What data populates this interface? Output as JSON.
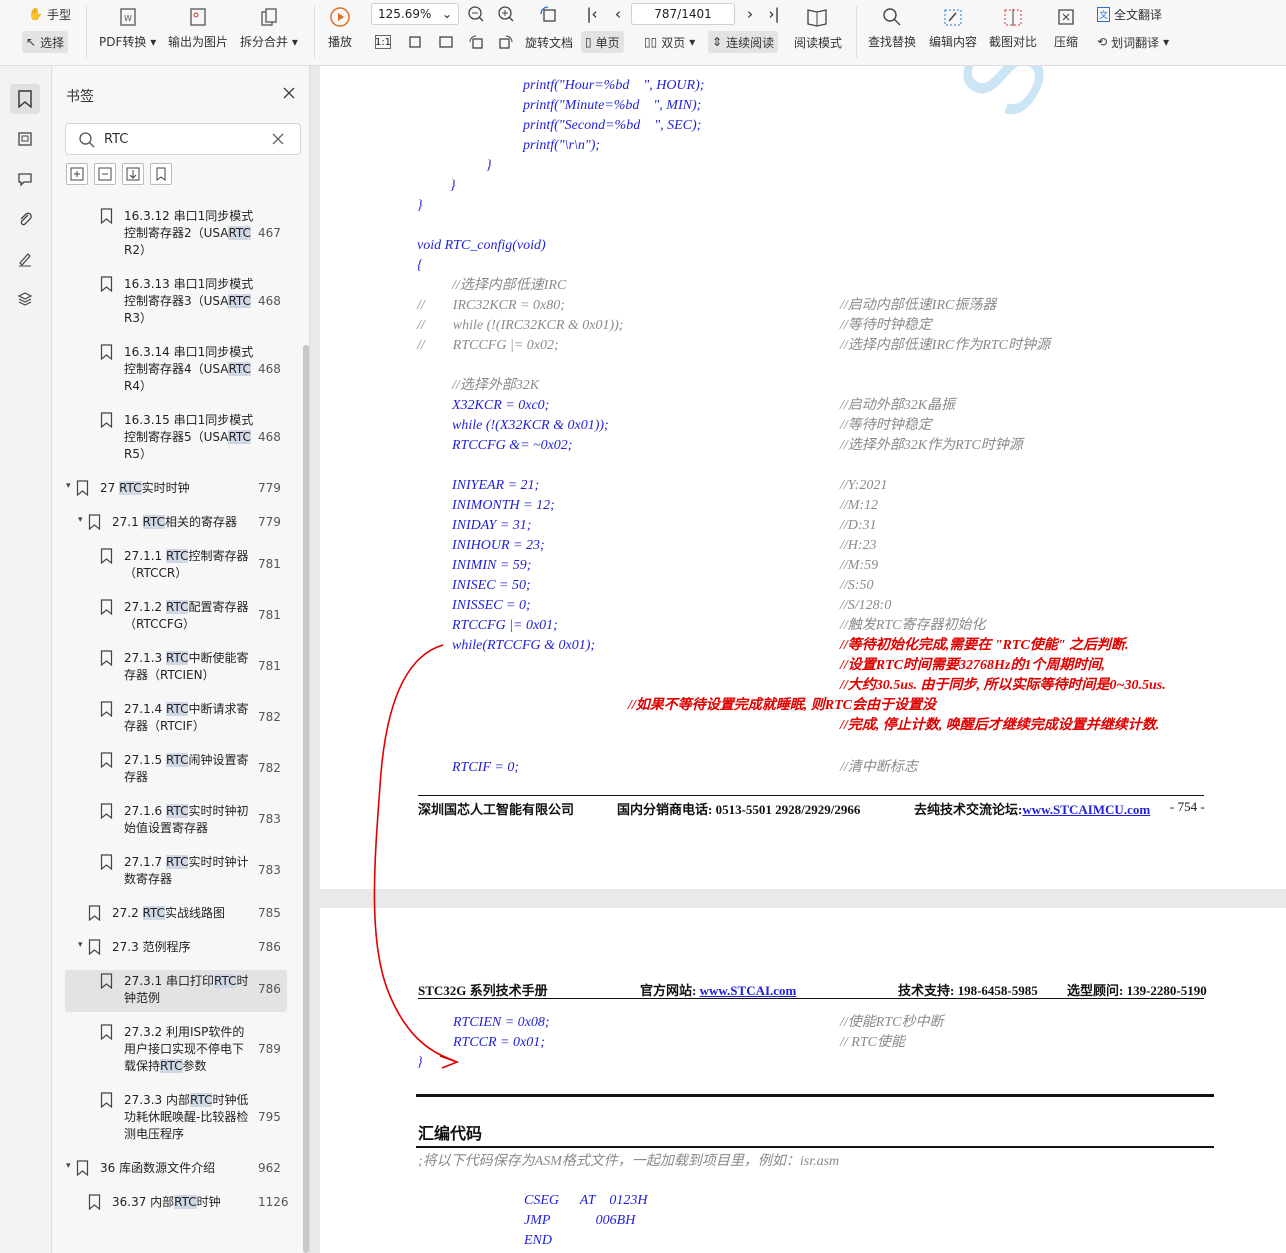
{
  "toolbar": {
    "hand": "手型",
    "select": "选择",
    "pdf_convert": "PDF转换",
    "export_image": "输出为图片",
    "split_merge": "拆分合并",
    "play": "播放",
    "zoom": "125.69%",
    "page": "787/1401",
    "rotate": "旋转文档",
    "single": "单页",
    "double": "双页",
    "continuous": "连续阅读",
    "read_mode": "阅读模式",
    "find_replace": "查找替换",
    "edit_content": "编辑内容",
    "screenshot_compare": "截图对比",
    "compress": "压缩",
    "full_translate": "全文翻译",
    "word_translate": "划词翻译"
  },
  "panel": {
    "title": "书签",
    "search_value": "RTC",
    "items": [
      {
        "text_a": "16.3.12 串口1同步模式\n控制寄存器2（USA",
        "hl": "RTC",
        "text_b": "\nR2）",
        "page": "467"
      },
      {
        "text_a": "16.3.13 串口1同步模式\n控制寄存器3（USA",
        "hl": "RTC",
        "text_b": "\nR3）",
        "page": "468"
      },
      {
        "text_a": "16.3.14 串口1同步模式\n控制寄存器4（USA",
        "hl": "RTC",
        "text_b": "\nR4）",
        "page": "468"
      },
      {
        "text_a": "16.3.15 串口1同步模式\n控制寄存器5（USA",
        "hl": "RTC",
        "text_b": "\nR5）",
        "page": "468"
      },
      {
        "text_a": "27 ",
        "hl": "RTC",
        "text_b": "实时时钟",
        "page": "779"
      },
      {
        "text_a": "27.1 ",
        "hl": "RTC",
        "text_b": "相关的寄存器",
        "page": "779"
      },
      {
        "text_a": "27.1.1 ",
        "hl": "RTC",
        "text_b": "控制寄存器\n（RTCCR）",
        "page": "781"
      },
      {
        "text_a": "27.1.2 ",
        "hl": "RTC",
        "text_b": "配置寄存器\n（RTCCFG）",
        "page": "781"
      },
      {
        "text_a": "27.1.3 ",
        "hl": "RTC",
        "text_b": "中断使能寄\n存器（RTCIEN）",
        "page": "781"
      },
      {
        "text_a": "27.1.4 ",
        "hl": "RTC",
        "text_b": "中断请求寄\n存器（RTCIF）",
        "page": "782"
      },
      {
        "text_a": "27.1.5 ",
        "hl": "RTC",
        "text_b": "闹钟设置寄\n存器",
        "page": "782"
      },
      {
        "text_a": "27.1.6 ",
        "hl": "RTC",
        "text_b": "实时时钟初\n始值设置寄存器",
        "page": "783"
      },
      {
        "text_a": "27.1.7 ",
        "hl": "RTC",
        "text_b": "实时时钟计\n数寄存器",
        "page": "783"
      },
      {
        "text_a": "27.2 ",
        "hl": "RTC",
        "text_b": "实战线路图",
        "page": "785"
      },
      {
        "text_a": "27.3 范例程序",
        "hl": "",
        "text_b": "",
        "page": "786"
      },
      {
        "text_a": "27.3.1 串口打印",
        "hl": "RTC",
        "text_b": "时\n钟范例",
        "page": "786"
      },
      {
        "text_a": "27.3.2 利用ISP软件的\n用户接口实现不停电下\n载保持",
        "hl": "RTC",
        "text_b": "参数",
        "page": "789"
      },
      {
        "text_a": "27.3.3 内部",
        "hl": "RTC",
        "text_b": "时钟低\n功耗休眠唤醒-比较器检\n测电压程序",
        "page": "795"
      },
      {
        "text_a": "36 库函数源文件介绍",
        "hl": "",
        "text_b": "",
        "page": "962"
      },
      {
        "text_a": "36.37 内部",
        "hl": "RTC",
        "text_b": "时钟",
        "page": "1126"
      }
    ]
  },
  "doc": {
    "watermark": "STC MCU",
    "page1": {
      "lines": [
        {
          "text": "printf(\"Hour=%bd    \", HOUR);",
          "cls": "blue"
        },
        {
          "text": "printf(\"Minute=%bd    \", MIN);",
          "cls": "blue"
        },
        {
          "text": "printf(\"Second=%bd    \", SEC);",
          "cls": "blue"
        },
        {
          "text": "printf(\"\\r\\n\");",
          "cls": "blue"
        },
        {
          "text": "}",
          "cls": "blue"
        },
        {
          "text": "}",
          "cls": "blue"
        },
        {
          "text": "}",
          "cls": "blue"
        },
        {
          "text": "void RTC_config(void)",
          "cls": "blue"
        },
        {
          "text": "{",
          "cls": "blue"
        },
        {
          "text": "//选择内部低速IRC",
          "cls": "gray"
        },
        {
          "text": "//        IRC32KCR = 0x80;",
          "cls": "gray"
        },
        {
          "text": "//        while (!(IRC32KCR & 0x01));",
          "cls": "gray"
        },
        {
          "text": "//        RTCCFG |= 0x02;",
          "cls": "gray"
        },
        {
          "text": "//选择外部32K",
          "cls": "gray"
        },
        {
          "text": "X32KCR = 0xc0;",
          "cls": "blue"
        },
        {
          "text": "while (!(X32KCR & 0x01));",
          "cls": "blue"
        },
        {
          "text": "RTCCFG &= ~0x02;",
          "cls": "blue"
        },
        {
          "text": "INIYEAR = 21;",
          "cls": "blue"
        },
        {
          "text": "INIMONTH = 12;",
          "cls": "blue"
        },
        {
          "text": "INIDAY = 31;",
          "cls": "blue"
        },
        {
          "text": "INIHOUR = 23;",
          "cls": "blue"
        },
        {
          "text": "INIMIN = 59;",
          "cls": "blue"
        },
        {
          "text": "INISEC = 50;",
          "cls": "blue"
        },
        {
          "text": "INISSEC = 0;",
          "cls": "blue"
        },
        {
          "text": "RTCCFG |= 0x01;",
          "cls": "blue"
        },
        {
          "text": "while(RTCCFG & 0x01);",
          "cls": "blue"
        },
        {
          "text": "RTCIF = 0;",
          "cls": "blue"
        }
      ],
      "comments": [
        {
          "text": "//启动内部低速IRC振荡器",
          "cls": "gray"
        },
        {
          "text": "//等待时钟稳定",
          "cls": "gray"
        },
        {
          "text": "//选择内部低速IRC作为RTC时钟源",
          "cls": "gray"
        },
        {
          "text": "//启动外部32K晶振",
          "cls": "gray"
        },
        {
          "text": "//等待时钟稳定",
          "cls": "gray"
        },
        {
          "text": "//选择外部32K作为RTC时钟源",
          "cls": "gray"
        },
        {
          "text": "//Y:2021",
          "cls": "gray"
        },
        {
          "text": "//M:12",
          "cls": "gray"
        },
        {
          "text": "//D:31",
          "cls": "gray"
        },
        {
          "text": "//H:23",
          "cls": "gray"
        },
        {
          "text": "//M:59",
          "cls": "gray"
        },
        {
          "text": "//S:50",
          "cls": "gray"
        },
        {
          "text": "//S/128:0",
          "cls": "gray"
        },
        {
          "text": "//触发RTC寄存器初始化",
          "cls": "gray"
        },
        {
          "text": "//等待初始化完成,需要在 \"RTC使能\" 之后判断.",
          "cls": "red"
        },
        {
          "text": "//设置RTC时间需要32768Hz的1个周期时间,",
          "cls": "red"
        },
        {
          "text": "//大约30.5us. 由于同步, 所以实际等待时间是0~30.5us.",
          "cls": "red"
        },
        {
          "text": "//如果不等待设置完成就睡眠, 则RTC会由于设置没",
          "cls": "red"
        },
        {
          "text": "//完成, 停止计数, 唤醒后才继续完成设置并继续计数.",
          "cls": "red"
        },
        {
          "text": "//清中断标志",
          "cls": "gray"
        }
      ],
      "footer_company": "深圳国芯人工智能有限公司",
      "footer_phone_label": "国内分销商电话: 0513-5501 2928/2929/2966",
      "footer_forum_label": "去纯技术交流论坛:",
      "footer_forum_link": "www.STCAIMCU.com",
      "footer_page": "- 754 -"
    },
    "page2": {
      "header_manual": "STC32G 系列技术手册",
      "header_site_label": "官方网站:",
      "header_site_link": "www.STCAI.com",
      "header_support": "技术支持: 198-6458-5985",
      "header_consult": "选型顾问: 139-2280-5190",
      "line1": "RTCIEN = 0x08;",
      "cmt1": "//使能RTC秒中断",
      "line2": "RTCCR = 0x01;",
      "cmt2": "// RTC使能",
      "brace": "}",
      "section": "汇编代码",
      "asm_note": ";将以下代码保存为ASM格式文件，一起加载到项目里，例如：isr.asm",
      "asm1": "CSEG      AT    0123H",
      "asm2": "JMP             006BH",
      "asm3": "END"
    }
  }
}
